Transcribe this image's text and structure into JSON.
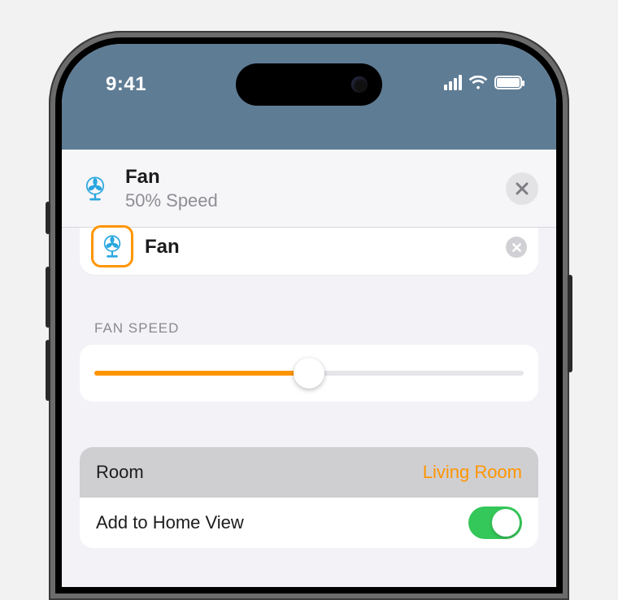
{
  "status": {
    "time": "9:41"
  },
  "sheet": {
    "title": "Fan",
    "subtitle": "50% Speed"
  },
  "peek": {
    "title": "Fan"
  },
  "fan_speed": {
    "label": "FAN SPEED",
    "percent": 50
  },
  "rows": {
    "room": {
      "label": "Room",
      "value": "Living Room"
    },
    "home_view": {
      "label": "Add to Home View",
      "on": true
    }
  },
  "colors": {
    "accent": "#ff9500",
    "switch_on": "#34c759",
    "header_bg": "#5f7c95",
    "fan_icon": "#2aa7e0"
  }
}
